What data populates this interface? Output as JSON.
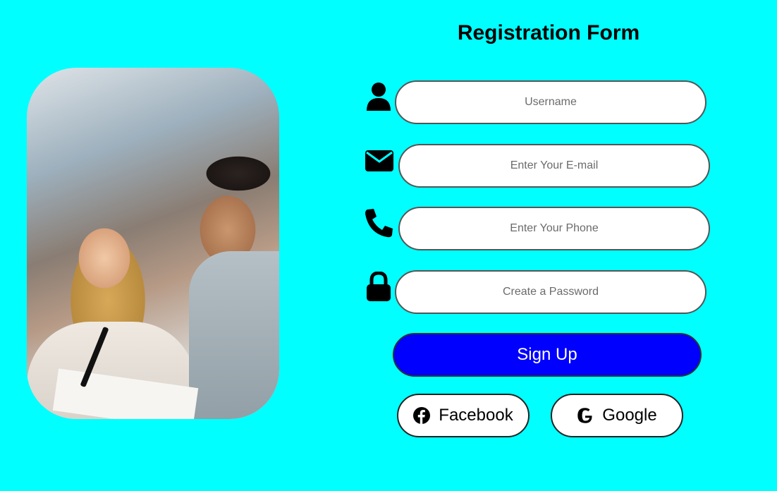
{
  "form": {
    "title": "Registration Form",
    "username": {
      "placeholder": "Username",
      "icon": "user-icon"
    },
    "email": {
      "placeholder": "Enter Your E-mail",
      "icon": "envelope-icon"
    },
    "phone": {
      "placeholder": "Enter Your Phone",
      "icon": "phone-icon"
    },
    "password": {
      "placeholder": "Create a Password",
      "icon": "lock-icon"
    },
    "signup_label": "Sign Up",
    "facebook_label": "Facebook",
    "google_label": "Google"
  },
  "colors": {
    "background": "#00ffff",
    "signup_button": "#0000ff"
  }
}
